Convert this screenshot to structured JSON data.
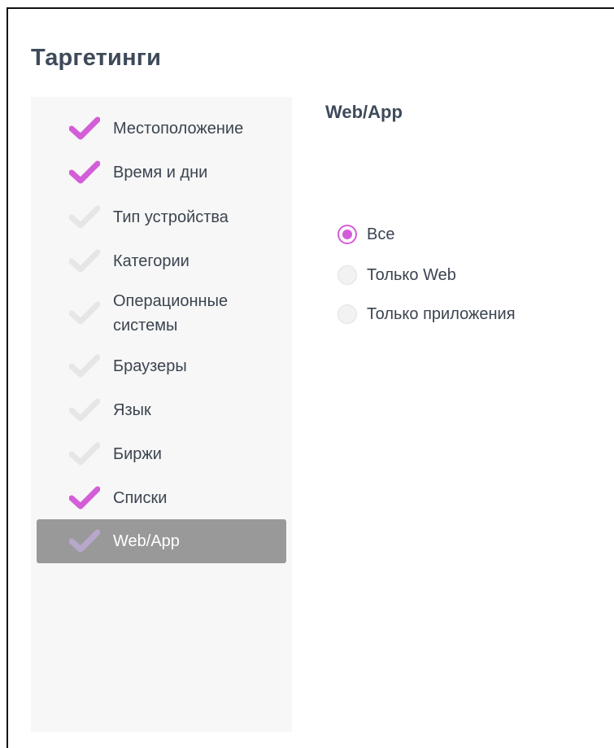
{
  "page": {
    "title": "Таргетинги"
  },
  "sidebar": {
    "items": [
      {
        "label": "Местоположение",
        "checked": true
      },
      {
        "label": "Время и дни",
        "checked": true
      },
      {
        "label": "Тип устройства",
        "checked": false
      },
      {
        "label": "Категории",
        "checked": false
      },
      {
        "label": "Операционные системы",
        "checked": false
      },
      {
        "label": "Браузеры",
        "checked": false
      },
      {
        "label": "Язык",
        "checked": false
      },
      {
        "label": "Биржи",
        "checked": false
      },
      {
        "label": "Списки",
        "checked": true
      },
      {
        "label": "Web/App",
        "checked": true,
        "active": true
      }
    ]
  },
  "main": {
    "section_title": "Web/App",
    "options": [
      {
        "label": "Все",
        "selected": true
      },
      {
        "label": "Только Web",
        "selected": false
      },
      {
        "label": "Только приложения",
        "selected": false
      }
    ]
  },
  "colors": {
    "accent": "#d35ed8",
    "check_inactive": "#e6e6e6",
    "check_on_active": "#b8a7cc",
    "active_bg": "#999999",
    "sidebar_bg": "#f7f7f7"
  }
}
